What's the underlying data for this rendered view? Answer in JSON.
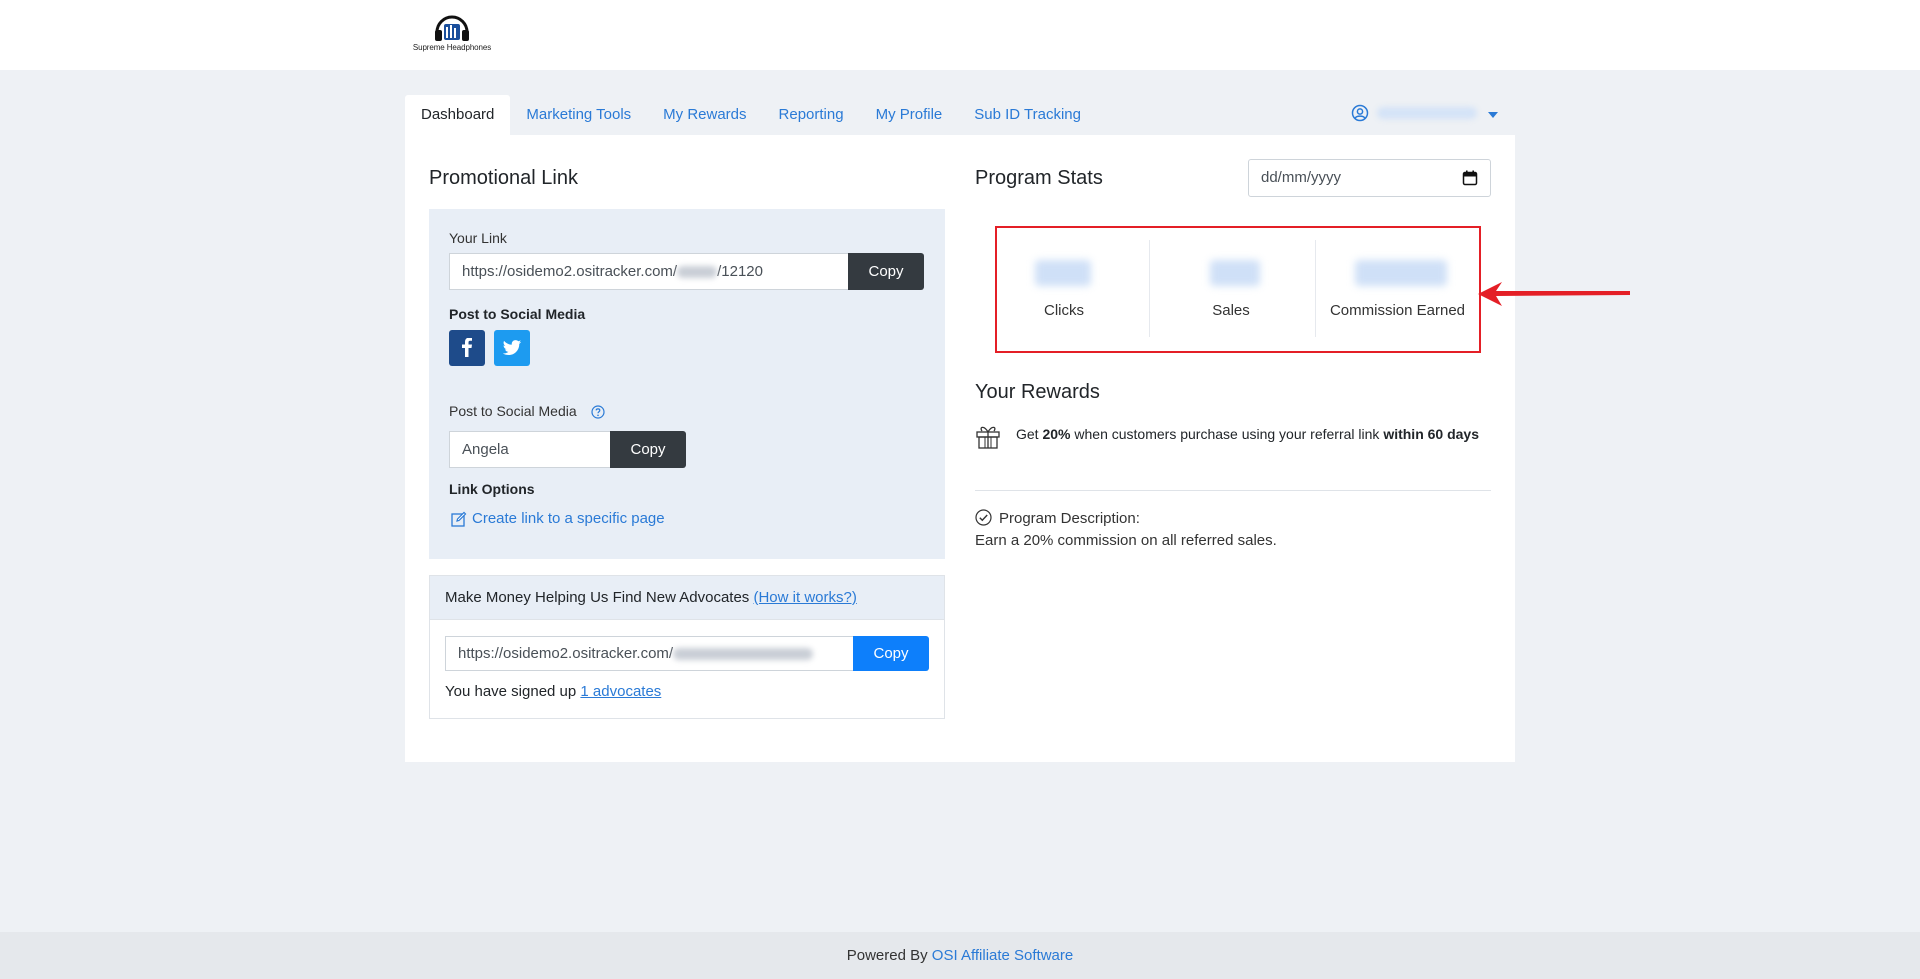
{
  "brand": {
    "logo_text": "Supreme Headphones"
  },
  "nav": {
    "tabs": [
      {
        "label": "Dashboard"
      },
      {
        "label": "Marketing Tools"
      },
      {
        "label": "My Rewards"
      },
      {
        "label": "Reporting"
      },
      {
        "label": "My Profile"
      },
      {
        "label": "Sub ID Tracking"
      }
    ],
    "active_tab": "Dashboard"
  },
  "promo": {
    "title": "Promotional Link",
    "your_link_label": "Your Link",
    "your_link_value": "https://osidemo2.ositracker.com/",
    "your_link_suffix": "/12120",
    "copy_label": "Copy",
    "social_label": "Post to Social Media",
    "social_label_2": "Post to Social Media",
    "name_value": "Angela",
    "link_options_label": "Link Options",
    "create_link_label": "Create link to a specific page"
  },
  "advocates": {
    "heading": "Make Money Helping Us Find New Advocates ",
    "how_it_works": "(How it works?)",
    "link_value": "https://osidemo2.ositracker.com/",
    "copy_label": "Copy",
    "signed_up_text": "You have signed up ",
    "advocates_link": "1 advocates"
  },
  "stats": {
    "title": "Program Stats",
    "date_placeholder": "dd/mm/yyyy",
    "items": [
      {
        "label": "Clicks"
      },
      {
        "label": "Sales"
      },
      {
        "label": "Commission Earned"
      }
    ]
  },
  "rewards": {
    "title": "Your Rewards",
    "text_1": "Get ",
    "percent": "20%",
    "text_2": " when customers purchase using your referral link ",
    "text_3": "within 60 days"
  },
  "program": {
    "description_label": "Program Description:",
    "description_text": "Earn a 20% commission on all referred sales."
  },
  "footer": {
    "powered_by": "Powered By ",
    "link": "OSI Affiliate Software"
  },
  "colors": {
    "accent": "#2a7ad6",
    "highlight_box": "#e41f26",
    "button_dark": "#343a40",
    "button_blue": "#0d7ffb"
  }
}
